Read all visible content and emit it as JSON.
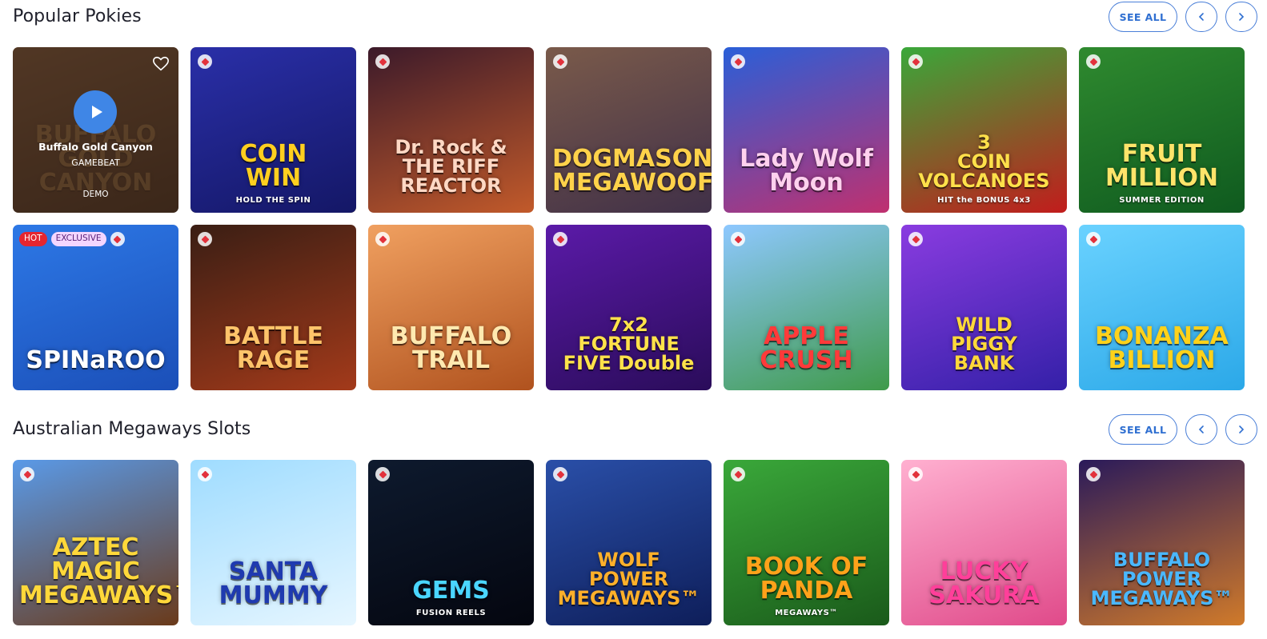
{
  "sections": [
    {
      "title": "Popular Pokies",
      "see_all": "SEE ALL",
      "games": [
        {
          "name": "Buffalo Gold Canyon",
          "provider": "GAMEBEAT",
          "action": "DEMO",
          "logo_lines": [
            "BUFFALO",
            "GOLD CANYON"
          ],
          "bg": [
            "#6b4a2e",
            "#3a2616"
          ],
          "logo_color": "#d9a85a"
        },
        {
          "name": "Coin Win",
          "logo_lines": [
            "COIN",
            "WIN"
          ],
          "sub": "HOLD THE SPIN",
          "bg": [
            "#2a2fa8",
            "#141766"
          ],
          "logo_color": "#ffcf1f"
        },
        {
          "name": "Dr. Rock & The Riff Reactor",
          "logo_lines": [
            "Dr. Rock &",
            "THE RIFF",
            "REACTOR"
          ],
          "bg": [
            "#3c1a2a",
            "#c25a2a"
          ],
          "logo_color": "#ffd8c4"
        },
        {
          "name": "Dogmasons MegaWoof",
          "logo_lines": [
            "DOGMASONS",
            "MEGAWOOF"
          ],
          "bg": [
            "#7a5a4a",
            "#403048"
          ],
          "logo_color": "#ffd24a"
        },
        {
          "name": "Lady Wolf Moon",
          "logo_lines": [
            "Lady Wolf",
            "Moon"
          ],
          "bg": [
            "#2a5fd8",
            "#c0306f"
          ],
          "logo_color": "#ffd1ee"
        },
        {
          "name": "3 Coin Volcanoes",
          "logo_lines": [
            "3",
            "COIN",
            "VOLCANOES"
          ],
          "sub": "HIT the BONUS 4x3",
          "bg": [
            "#3aa83a",
            "#c21c1c"
          ],
          "logo_color": "#ffe04a"
        },
        {
          "name": "Fruit Million",
          "logo_lines": [
            "FRUIT",
            "MILLION"
          ],
          "sub": "SUMMER EDITION",
          "bg": [
            "#2f8a2f",
            "#0f5a1f"
          ],
          "logo_color": "#ffe46a"
        },
        {
          "name": "Spinaroo",
          "badges": [
            "HOT",
            "EXCLUSIVE"
          ],
          "logo_lines": [
            "SPINaROO"
          ],
          "bg": [
            "#2d78e6",
            "#1b4fb8"
          ],
          "logo_color": "#ffffff"
        },
        {
          "name": "Battle Rage",
          "logo_lines": [
            "BATTLE",
            "RAGE"
          ],
          "bg": [
            "#3a1e14",
            "#a33a1a"
          ],
          "logo_color": "#ffc46a"
        },
        {
          "name": "Buffalo Trail",
          "logo_lines": [
            "BUFFALO TRAIL"
          ],
          "bg": [
            "#f0a060",
            "#b0521e"
          ],
          "logo_color": "#ffe9b0"
        },
        {
          "name": "Fortune Five Double",
          "logo_lines": [
            "7x2",
            "FORTUNE",
            "FIVE Double"
          ],
          "bg": [
            "#5b1aa8",
            "#2a0c5a"
          ],
          "logo_color": "#ffe24a"
        },
        {
          "name": "Apple Crush",
          "logo_lines": [
            "APPLE",
            "CRUSH"
          ],
          "bg": [
            "#8ec8ff",
            "#3f9a4a"
          ],
          "logo_color": "#ff3a3a"
        },
        {
          "name": "Wild Piggy Bank",
          "logo_lines": [
            "WILD",
            "PIGGY",
            "BANK"
          ],
          "bg": [
            "#8a3ce0",
            "#3420a8"
          ],
          "logo_color": "#ffd83a"
        },
        {
          "name": "Bonanza Billion",
          "logo_lines": [
            "BONANZA",
            "BILLION"
          ],
          "bg": [
            "#6ad2ff",
            "#2ba8e8"
          ],
          "logo_color": "#ffd21a"
        }
      ]
    },
    {
      "title": "Australian Megaways Slots",
      "see_all": "SEE ALL",
      "games": [
        {
          "name": "Aztec Magic Megaways",
          "logo_lines": [
            "AZTEC MAGIC",
            "MEGAWAYS™"
          ],
          "bg": [
            "#5a9ae8",
            "#6a3a1a"
          ],
          "logo_color": "#ffd83a"
        },
        {
          "name": "Santa Mummy",
          "logo_lines": [
            "SANTA",
            "MUMMY"
          ],
          "bg": [
            "#9fdcff",
            "#e6f6ff"
          ],
          "logo_color": "#1f3ab0"
        },
        {
          "name": "Gems Fusion Reels",
          "logo_lines": [
            "GEMS"
          ],
          "sub": "FUSION REELS",
          "bg": [
            "#0e1a2e",
            "#04060f"
          ],
          "logo_color": "#4ad6ff"
        },
        {
          "name": "Wolf Power Megaways",
          "logo_lines": [
            "WOLF",
            "POWER",
            "MEGAWAYS™"
          ],
          "bg": [
            "#2a4fa8",
            "#0e1e5a"
          ],
          "logo_color": "#ffb02a"
        },
        {
          "name": "Book of Panda Megaways",
          "logo_lines": [
            "BOOK OF",
            "PANDA"
          ],
          "sub": "MEGAWAYS™",
          "bg": [
            "#3aa83a",
            "#1a5a1a"
          ],
          "logo_color": "#ffa21a"
        },
        {
          "name": "Lucky Sakura",
          "logo_lines": [
            "LUCKY",
            "SAKURA"
          ],
          "bg": [
            "#ffb0d0",
            "#e04a8a"
          ],
          "logo_color": "#ff3f9a"
        },
        {
          "name": "Buffalo Power Megaways",
          "logo_lines": [
            "BUFFALO",
            "POWER",
            "MEGAWAYS™"
          ],
          "bg": [
            "#2a1a5a",
            "#d07a2a"
          ],
          "logo_color": "#4ab8ff"
        }
      ]
    }
  ]
}
